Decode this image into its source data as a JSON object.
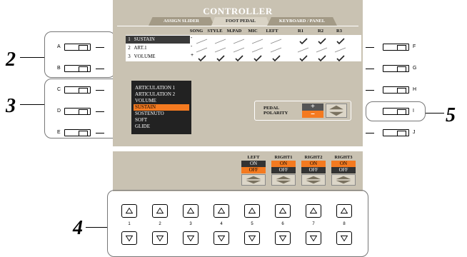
{
  "screen": {
    "title": "CONTROLLER",
    "tabs": [
      "ASSIGN SLIDER",
      "FOOT PEDAL",
      "KEYBOARD / PANEL"
    ],
    "active_tab": "FOOT PEDAL",
    "columns": [
      "SONG",
      "STYLE",
      "M.PAD",
      "MIC",
      "LEFT",
      "R1",
      "R2",
      "R3"
    ],
    "pedals": [
      {
        "num": "1",
        "name": "SUSTAIN",
        "sign": "-",
        "checks": [
          false,
          false,
          false,
          false,
          false,
          true,
          true,
          true
        ]
      },
      {
        "num": "2",
        "name": "ART.1",
        "sign": "-",
        "checks": [
          false,
          false,
          false,
          false,
          false,
          false,
          false,
          false
        ]
      },
      {
        "num": "3",
        "name": "VOLUME",
        "sign": "+",
        "checks": [
          true,
          true,
          true,
          true,
          true,
          true,
          true,
          true
        ]
      }
    ],
    "function_list": [
      "ARTICULATION 1",
      "ARTICULATION 2",
      "VOLUME",
      "SUSTAIN",
      "SOSTENUTO",
      "SOFT",
      "GLIDE"
    ],
    "function_selected": "SUSTAIN",
    "polarity": {
      "label_line1": "PEDAL",
      "label_line2": "POLARITY",
      "plus": "+",
      "minus": "–",
      "selected": "minus"
    }
  },
  "panel": {
    "tracks": [
      {
        "name": "LEFT",
        "on": "ON",
        "off": "OFF",
        "selected": "off"
      },
      {
        "name": "RIGHT1",
        "on": "ON",
        "off": "OFF",
        "selected": "on"
      },
      {
        "name": "RIGHT2",
        "on": "ON",
        "off": "OFF",
        "selected": "on"
      },
      {
        "name": "RIGHT3",
        "on": "ON",
        "off": "OFF",
        "selected": "on"
      }
    ]
  },
  "side_buttons": {
    "left": [
      "A",
      "B",
      "C",
      "D",
      "E"
    ],
    "right": [
      "F",
      "G",
      "H",
      "I",
      "J"
    ]
  },
  "number_buttons": [
    "1",
    "2",
    "3",
    "4",
    "5",
    "6",
    "7",
    "8"
  ],
  "callouts": [
    "2",
    "3",
    "4",
    "5"
  ],
  "icons": {
    "pedal_up_arrow": "triangle-up-icon",
    "pedal_down_arrow": "triangle-down-icon",
    "check": "checkmark-icon"
  },
  "colors": {
    "screen_bg": "#c9c2b2",
    "accent": "#f47a20",
    "dark": "#222222"
  }
}
